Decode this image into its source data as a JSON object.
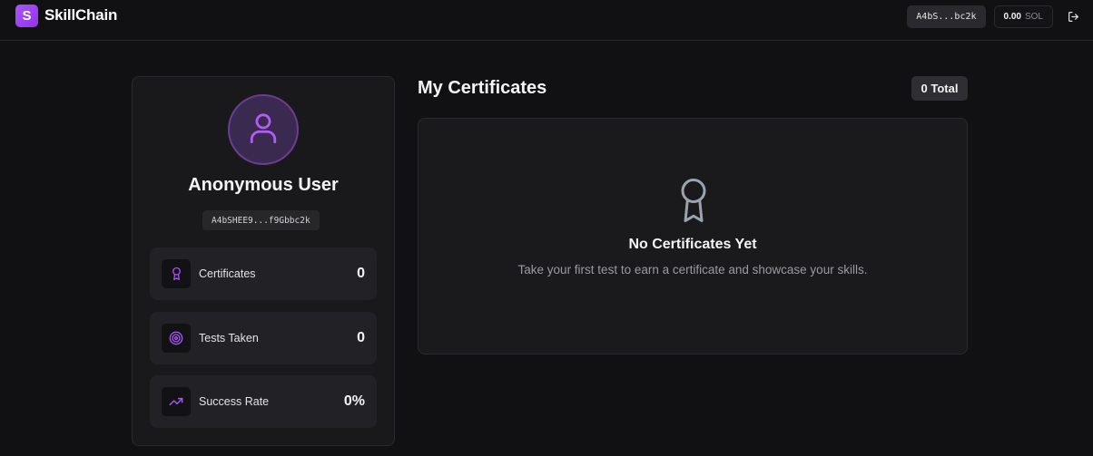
{
  "header": {
    "logo_letter": "S",
    "brand": "SkillChain",
    "wallet_short": "A4bS...bc2k",
    "sol_amount": "0.00",
    "sol_currency": "SOL",
    "logout_icon": "logout-icon"
  },
  "profile": {
    "avatar_icon": "user-icon",
    "name": "Anonymous User",
    "address": "A4bSHEE9...f9Gbbc2k",
    "stats": [
      {
        "icon": "award-icon",
        "label": "Certificates",
        "value": "0"
      },
      {
        "icon": "target-icon",
        "label": "Tests Taken",
        "value": "0"
      },
      {
        "icon": "trending-up-icon",
        "label": "Success Rate",
        "value": "0%"
      }
    ]
  },
  "certificates": {
    "title": "My Certificates",
    "total": "0 Total",
    "empty_icon": "award-icon",
    "empty_title": "No Certificates Yet",
    "empty_desc": "Take your first test to earn a certificate and showcase your skills."
  },
  "colors": {
    "background": "#111113",
    "accent": "#a855f7",
    "card": "#19191c"
  }
}
